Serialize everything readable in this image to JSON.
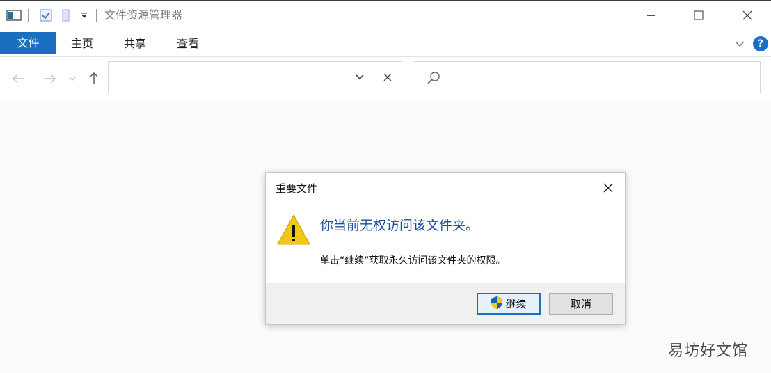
{
  "window": {
    "title": "文件资源管理器"
  },
  "ribbon": {
    "tabs": [
      {
        "label": "文件",
        "active": true
      },
      {
        "label": "主页"
      },
      {
        "label": "共享"
      },
      {
        "label": "查看"
      }
    ],
    "help_label": "?"
  },
  "navbar": {
    "address_value": "",
    "search_placeholder": ""
  },
  "dialog": {
    "title": "重要文件",
    "heading": "你当前无权访问该文件夹。",
    "body": "单击“继续”获取永久访问该文件夹的权限。",
    "continue_label": "继续",
    "cancel_label": "取消"
  },
  "watermark": {
    "text": "易坊好文馆"
  },
  "colors": {
    "accent": "#1a6fc1",
    "heading_blue": "#1a4fa0",
    "warning_yellow": "#f2c813"
  }
}
